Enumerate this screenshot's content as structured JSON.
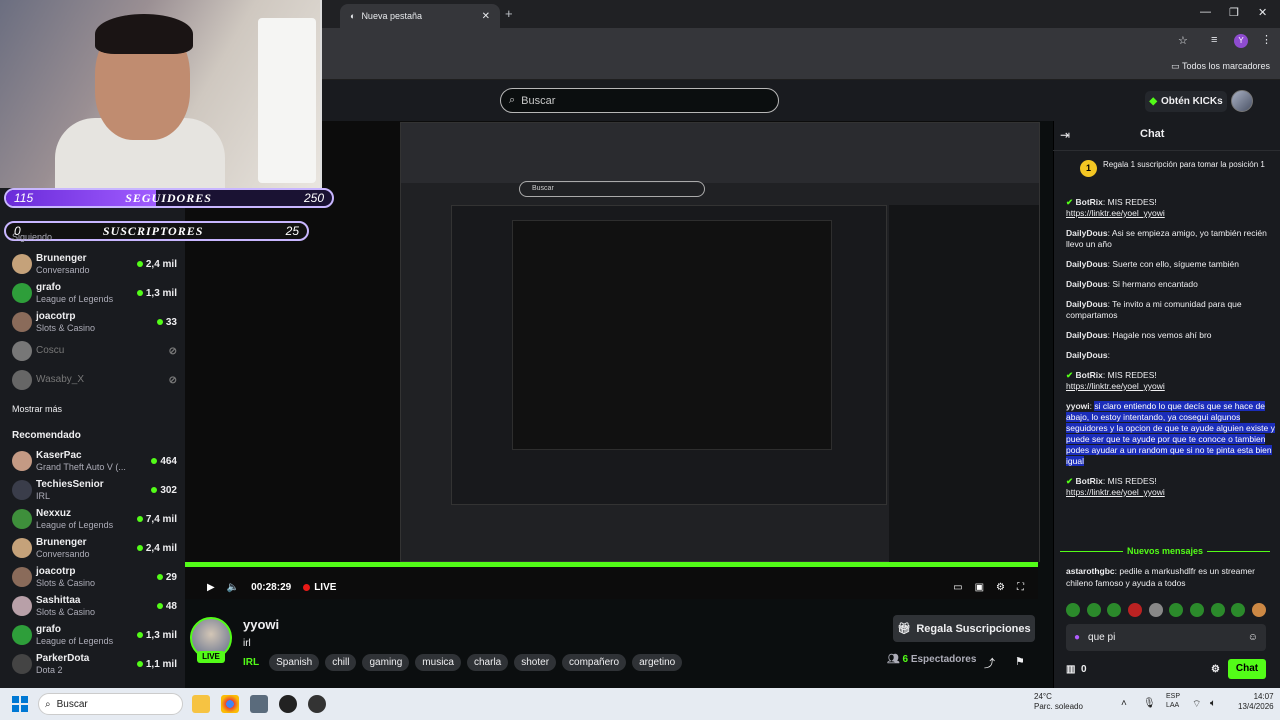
{
  "browser": {
    "tab_title": "Nueva pestaña",
    "new_tab": "+",
    "bookmarks_label": "Todos los marcadores",
    "profile_initial": "Y"
  },
  "header": {
    "search_placeholder": "Buscar",
    "kicks_label": "Obtén KICKs"
  },
  "overlay": {
    "followers_goal": {
      "current": "115",
      "label": "SEGUIDORES",
      "target": "250",
      "progress": 0.46
    },
    "subs_goal": {
      "current": "0",
      "label": "SUSCRIPTORES",
      "target": "25",
      "progress": 0.0
    },
    "siguiendo": "Siguiendo"
  },
  "sidebar": {
    "following": [
      {
        "name": "Brunenger",
        "category": "Conversando",
        "viewers": "2,4 mil",
        "live": true
      },
      {
        "name": "grafo",
        "category": "League of Legends",
        "viewers": "1,3 mil",
        "live": true
      },
      {
        "name": "joacotrp",
        "category": "Slots & Casino",
        "viewers": "33",
        "live": true
      },
      {
        "name": "Coscu",
        "category": "",
        "viewers": "",
        "live": false
      },
      {
        "name": "Wasaby_X",
        "category": "",
        "viewers": "",
        "live": false
      }
    ],
    "show_more": "Mostrar más",
    "recommended_title": "Recomendado",
    "recommended": [
      {
        "name": "KaserPac",
        "category": "Grand Theft Auto V (...",
        "viewers": "464"
      },
      {
        "name": "TechiesSenior",
        "category": "IRL",
        "viewers": "302"
      },
      {
        "name": "Nexxuz",
        "category": "League of Legends",
        "viewers": "7,4 mil"
      },
      {
        "name": "Brunenger",
        "category": "Conversando",
        "viewers": "2,4 mil"
      },
      {
        "name": "joacotrp",
        "category": "Slots & Casino",
        "viewers": "29"
      },
      {
        "name": "Sashittaa",
        "category": "Slots & Casino",
        "viewers": "48"
      },
      {
        "name": "grafo",
        "category": "League of Legends",
        "viewers": "1,3 mil"
      },
      {
        "name": "ParkerDota",
        "category": "Dota 2",
        "viewers": "1,1 mil"
      }
    ]
  },
  "player": {
    "time": "00:28:29",
    "live_label": "LIVE",
    "nested_search": "Buscar",
    "nested_tab": "Nueva pestaña"
  },
  "stream": {
    "streamer": "yyowi",
    "title": "irl",
    "live_badge": "LIVE",
    "category": "IRL",
    "tags": [
      "Spanish",
      "chill",
      "gaming",
      "musica",
      "charla",
      "shoter",
      "compañero",
      "argetino"
    ],
    "gift_button": "Regala Suscripciones",
    "viewers_count": "6",
    "viewers_label": "Espectadores"
  },
  "chat": {
    "title": "Chat",
    "pinned_rank": "1",
    "pinned_text": "Regala 1 suscripción para tomar la posición 1",
    "messages": [
      {
        "user": "BotRix",
        "text": "MIS REDES!",
        "link": "https://linktr.ee/yoel_yyowi"
      },
      {
        "user": "DailyDous",
        "text": "Asi se empieza amigo, yo también recién llevo un año"
      },
      {
        "user": "DailyDous",
        "text": "Suerte con ello, sígueme también"
      },
      {
        "user": "DailyDous",
        "text": "Si hermano encantado"
      },
      {
        "user": "DailyDous",
        "text": "Te invito a mi comunidad para que compartamos"
      },
      {
        "user": "DailyDous",
        "text": "Hagale nos vemos ahí bro"
      },
      {
        "user": "DailyDous",
        "text": ""
      },
      {
        "user": "BotRix",
        "text": "MIS REDES!",
        "link": "https://linktr.ee/yoel_yyowi"
      },
      {
        "user": "yyowi",
        "text": "si claro entiendo lo que decís que se hace de abajo, lo estoy intentando, ya cosegui algunos seguidores y la opcion de que te ayude alguien existe y puede ser que te ayude por que te conoce o tambien podes ayudar a un random que si no te pinta esta bien igual"
      },
      {
        "user": "BotRix",
        "text": "MIS REDES!",
        "link": "https://linktr.ee/yoel_yyowi"
      }
    ],
    "overlay_alert": "astarothgbc : pedile a markushdlfr es un streamer chileno famoso y ayuda a todos",
    "new_messages": "Nuevos mensajes",
    "last_message_user": "astarothgbc",
    "last_message_text": "pedile a markushdlfr es un streamer chileno famoso y ayuda a todos",
    "input_value": "que pi",
    "kicks_balance": "0",
    "send_button": "Chat"
  },
  "taskbar": {
    "search_placeholder": "Buscar",
    "temperature": "24°C",
    "weather": "Parc. soleado",
    "lang_line1": "ESP",
    "lang_line2": "LAA",
    "time": "14:07",
    "date": "13/4/2026"
  },
  "colors": {
    "accent": "#53fc18",
    "background": "#0b0e0f",
    "panel": "#191b1f",
    "highlight": "#1b2dba",
    "goal_purple": "#a05cff"
  }
}
